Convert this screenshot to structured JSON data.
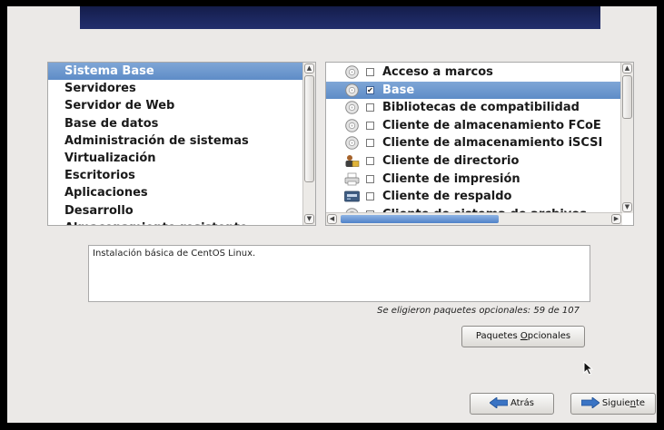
{
  "window": {
    "accent": "#5e8cc7",
    "banner_color": "#1c275f"
  },
  "groups": {
    "items": [
      {
        "label": "Sistema Base",
        "selected": true
      },
      {
        "label": "Servidores",
        "selected": false
      },
      {
        "label": "Servidor de Web",
        "selected": false
      },
      {
        "label": "Base de datos",
        "selected": false
      },
      {
        "label": "Administración de sistemas",
        "selected": false
      },
      {
        "label": "Virtualización",
        "selected": false
      },
      {
        "label": "Escritorios",
        "selected": false
      },
      {
        "label": "Aplicaciones",
        "selected": false
      },
      {
        "label": "Desarrollo",
        "selected": false
      },
      {
        "label": "Almacenamiento resistente",
        "selected": false
      }
    ]
  },
  "packages": {
    "items": [
      {
        "label": "Acceso a marcos",
        "icon": "disc-icon",
        "checked": false,
        "selected": false
      },
      {
        "label": "Base",
        "icon": "disc-icon",
        "checked": true,
        "selected": true
      },
      {
        "label": "Bibliotecas de compatibilidad",
        "icon": "disc-icon",
        "checked": false,
        "selected": false
      },
      {
        "label": "Cliente de almacenamiento FCoE",
        "icon": "disc-icon",
        "checked": false,
        "selected": false
      },
      {
        "label": "Cliente de almacenamiento iSCSI",
        "icon": "disc-icon",
        "checked": false,
        "selected": false
      },
      {
        "label": "Cliente de directorio",
        "icon": "directory-icon",
        "checked": false,
        "selected": false
      },
      {
        "label": "Cliente de impresión",
        "icon": "printer-icon",
        "checked": false,
        "selected": false
      },
      {
        "label": "Cliente de respaldo",
        "icon": "backup-icon",
        "checked": false,
        "selected": false
      },
      {
        "label": "Cliente de sistema de archivos",
        "icon": "disc-icon",
        "checked": false,
        "selected": false
      }
    ]
  },
  "description": "Instalación básica de CentOS Linux.",
  "optional_count_text": "Se eligieron paquetes opcionales: 59 de 107",
  "buttons": {
    "optional_packages_pre": "Paquetes ",
    "optional_packages_underline": "O",
    "optional_packages_post": "pcionales",
    "back": "Atrás",
    "next_pre": "Siguie",
    "next_underline": "n",
    "next_post": "te"
  }
}
